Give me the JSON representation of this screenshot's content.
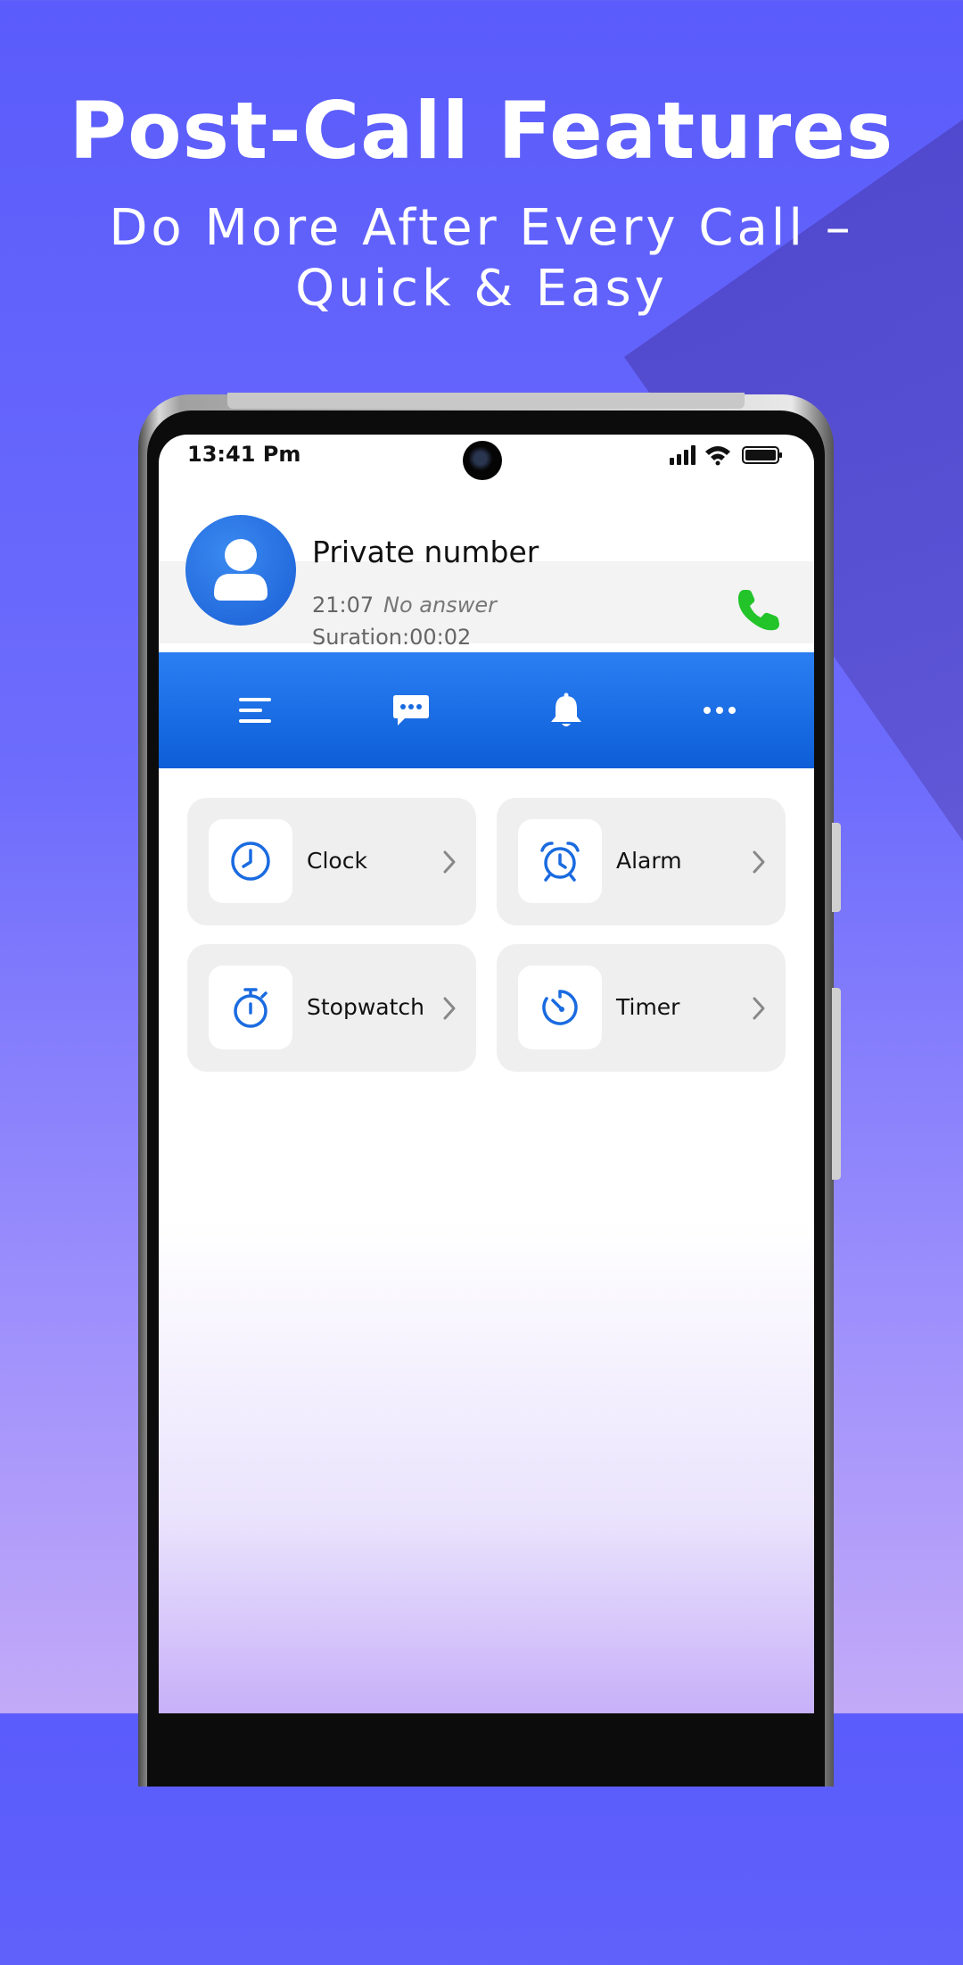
{
  "headline": "Post-Call Features",
  "subline": "Do More After Every Call – Quick & Easy",
  "status_bar": {
    "time": "13:41 Pm"
  },
  "contact": {
    "name": "Private number",
    "time": "21:07",
    "status": "No answer",
    "duration": "Suration:00:02"
  },
  "toolbar": {
    "items": [
      "menu-icon",
      "message-icon",
      "bell-icon",
      "more-icon"
    ]
  },
  "features": [
    {
      "label": "Clock",
      "icon": "clock-icon"
    },
    {
      "label": "Alarm",
      "icon": "alarm-icon"
    },
    {
      "label": "Stopwatch",
      "icon": "stopwatch-icon"
    },
    {
      "label": "Timer",
      "icon": "timer-icon"
    }
  ],
  "colors": {
    "accent": "#1a6be0",
    "call_green": "#22c42a",
    "background": "#5a5cfb"
  }
}
